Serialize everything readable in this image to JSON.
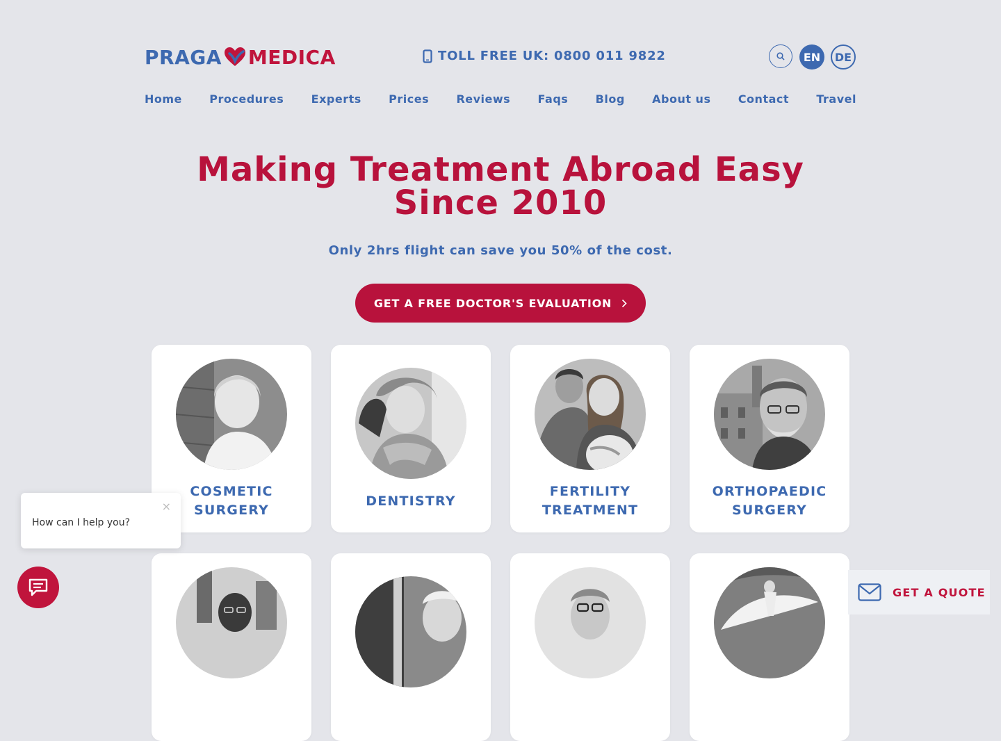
{
  "brand": {
    "part1": "PRAGA",
    "part2": "MEDICA",
    "heart_color": "#c0143c",
    "primary_color": "#3d69b0"
  },
  "header": {
    "tollfree": "TOLL FREE UK: 0800 011 9822",
    "languages": [
      "EN",
      "DE"
    ],
    "active_language": "EN"
  },
  "nav": [
    "Home",
    "Procedures",
    "Experts",
    "Prices",
    "Reviews",
    "Faqs",
    "Blog",
    "About us",
    "Contact",
    "Travel"
  ],
  "hero": {
    "title": "Making Treatment Abroad Easy Since 2010",
    "subtitle": "Only 2hrs flight can save you 50% of the cost.",
    "cta": "GET A FREE DOCTOR'S EVALUATION"
  },
  "cards": [
    {
      "label": "COSMETIC SURGERY"
    },
    {
      "label": "DENTISTRY"
    },
    {
      "label": "FERTILITY TREATMENT"
    },
    {
      "label": "ORTHOPAEDIC SURGERY"
    }
  ],
  "chat": {
    "prompt": "How can I help you?",
    "close": "×"
  },
  "quote": {
    "label": "GET A QUOTE"
  }
}
